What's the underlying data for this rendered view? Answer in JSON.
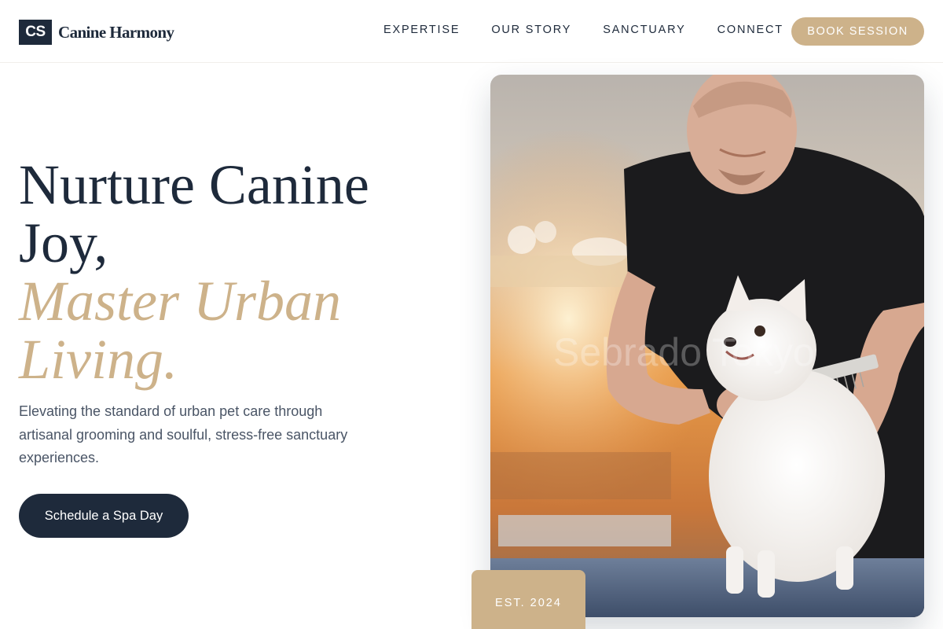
{
  "brand": {
    "mark": "CS",
    "name": "Canine Harmony"
  },
  "nav": {
    "items": [
      "EXPERTISE",
      "OUR STORY",
      "SANCTUARY",
      "CONNECT"
    ],
    "cta_label": "BOOK SESSION"
  },
  "hero": {
    "title_line1": "Nurture Canine",
    "title_line2": "Joy,",
    "title_accent_line1": "Master Urban",
    "title_accent_line2": "Living.",
    "description": "Elevating the standard of urban pet care through artisanal grooming and soulful, stress-free sanctuary experiences.",
    "cta_label": "Schedule a Spa Day",
    "established": "EST. 2024",
    "photo_watermark": "Sebrado Tokyo"
  },
  "colors": {
    "primary": "#1e2a3b",
    "accent": "#cdb28a",
    "text_muted": "#4a5566"
  }
}
